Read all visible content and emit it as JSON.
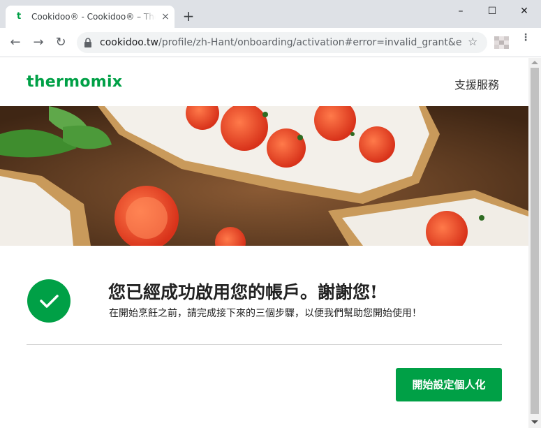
{
  "browser": {
    "tab_favicon": "t",
    "tab_title": "Cookidoo® - Cookidoo® – The",
    "tab_close": "×",
    "new_tab": "+",
    "window_controls": {
      "minimize": "–",
      "maximize": "☐",
      "close": "✕"
    },
    "nav": {
      "back": "←",
      "forward": "→",
      "reload": "↻"
    },
    "url_host": "cookidoo.tw",
    "url_path": "/profile/zh-Hant/onboarding/activation#error=invalid_grant&e...",
    "bookmark_star": "☆",
    "menu": "⋮"
  },
  "header": {
    "logo": "thermomix",
    "support_link": "支援服務"
  },
  "hero": {
    "image": "bruschetta-with-tomatoes-basil-and-ricotta"
  },
  "confirmation": {
    "icon": "check-icon",
    "headline": "您已經成功啟用您的帳戶。謝謝您!",
    "subtext": "在開始烹飪之前，請完成接下來的三個步驟，以便我們幫助您開始使用！",
    "cta_label": "開始設定個人化"
  },
  "colors": {
    "brand_green": "#00a046",
    "text_dark": "#222222",
    "chrome_bg": "#dee1e6"
  }
}
